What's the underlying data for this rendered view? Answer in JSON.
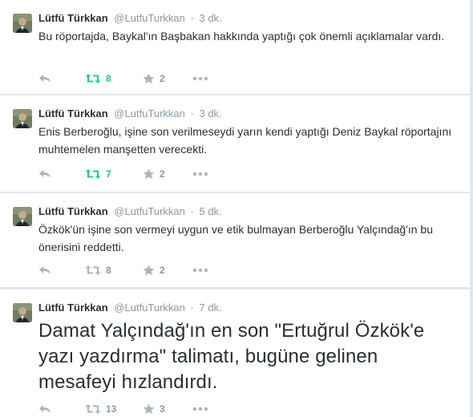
{
  "colors": {
    "retweet_active": "#19cf86",
    "action_gray": "#8899a6",
    "name": "#292f33"
  },
  "tweets": [
    {
      "fullname": "Lütfü Türkkan",
      "username": "@LutfuTurkkan",
      "separator": "·",
      "time": "3 dk.",
      "text": "Bu röportajda, Baykal'ın Başbakan hakkında yaptığı çok önemli açıklamalar vardı.",
      "retweets": "8",
      "retweet_active": true,
      "favorites": "2",
      "icons": [
        "reply-icon",
        "retweet-icon",
        "favorite-star-icon",
        "more-dots-icon"
      ]
    },
    {
      "fullname": "Lütfü Türkkan",
      "username": "@LutfuTurkkan",
      "separator": "·",
      "time": "3 dk.",
      "text": "Enis Berberoğlu, işine son verilmeseydi yarın kendi yaptığı Deniz Baykal röportajını muhtemelen manşetten verecekti.",
      "retweets": "7",
      "retweet_active": true,
      "favorites": "2",
      "icons": [
        "reply-icon",
        "retweet-icon",
        "favorite-star-icon",
        "more-dots-icon"
      ]
    },
    {
      "fullname": "Lütfü Türkkan",
      "username": "@LutfuTurkkan",
      "separator": "·",
      "time": "5 dk.",
      "text": "Özkök'ün işine son vermeyi uygun ve etik bulmayan Berberoğlu Yalçındağ'ın bu önerisini reddetti.",
      "retweets": "8",
      "retweet_active": false,
      "favorites": "2",
      "icons": [
        "reply-icon",
        "retweet-icon",
        "favorite-star-icon",
        "more-dots-icon"
      ]
    },
    {
      "fullname": "Lütfü Türkkan",
      "username": "@LutfuTurkkan",
      "separator": "·",
      "time": "7 dk.",
      "text": "Damat Yalçındağ'ın en son \"Ertuğrul Özkök'e yazı yazdırma\" talimatı, bugüne gelinen mesafeyi hızlandırdı.",
      "retweets": "13",
      "retweet_active": false,
      "favorites": "3",
      "icons": [
        "reply-icon",
        "retweet-icon",
        "favorite-star-icon",
        "more-dots-icon"
      ]
    }
  ]
}
